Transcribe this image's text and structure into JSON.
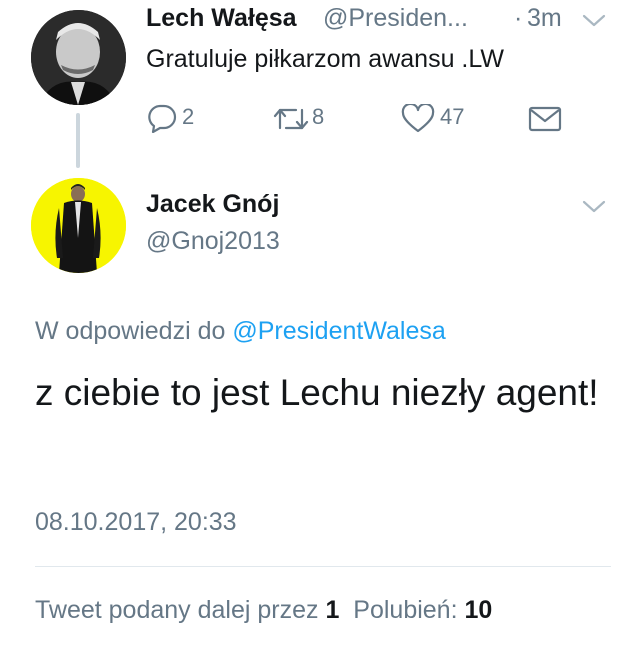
{
  "parent_tweet": {
    "author_name": "Lech Wałęsa",
    "author_handle": "@Presiden...",
    "separator": "·",
    "time": "3m",
    "text": "Gratuluje piłkarzom awansu .LW",
    "actions": {
      "replies": "2",
      "retweets": "8",
      "likes": "47"
    }
  },
  "main_tweet": {
    "author_name": "Jacek Gnój",
    "author_handle": "@Gnoj2013",
    "reply_prefix": "W odpowiedzi do",
    "reply_to": "@PresidentWalesa",
    "text": "z ciebie to jest Lechu niezły agent!",
    "timestamp": "08.10.2017, 20:33",
    "stats": {
      "retweets_label": "Tweet podany dalej przez",
      "retweets_count": "1",
      "likes_label": "Polubień:",
      "likes_count": "10"
    }
  },
  "colors": {
    "accent": "#1da1f2",
    "muted": "#657786",
    "text": "#14171a"
  },
  "icons": [
    "reply-icon",
    "retweet-icon",
    "like-icon",
    "direct-message-icon",
    "chevron-down-icon"
  ]
}
